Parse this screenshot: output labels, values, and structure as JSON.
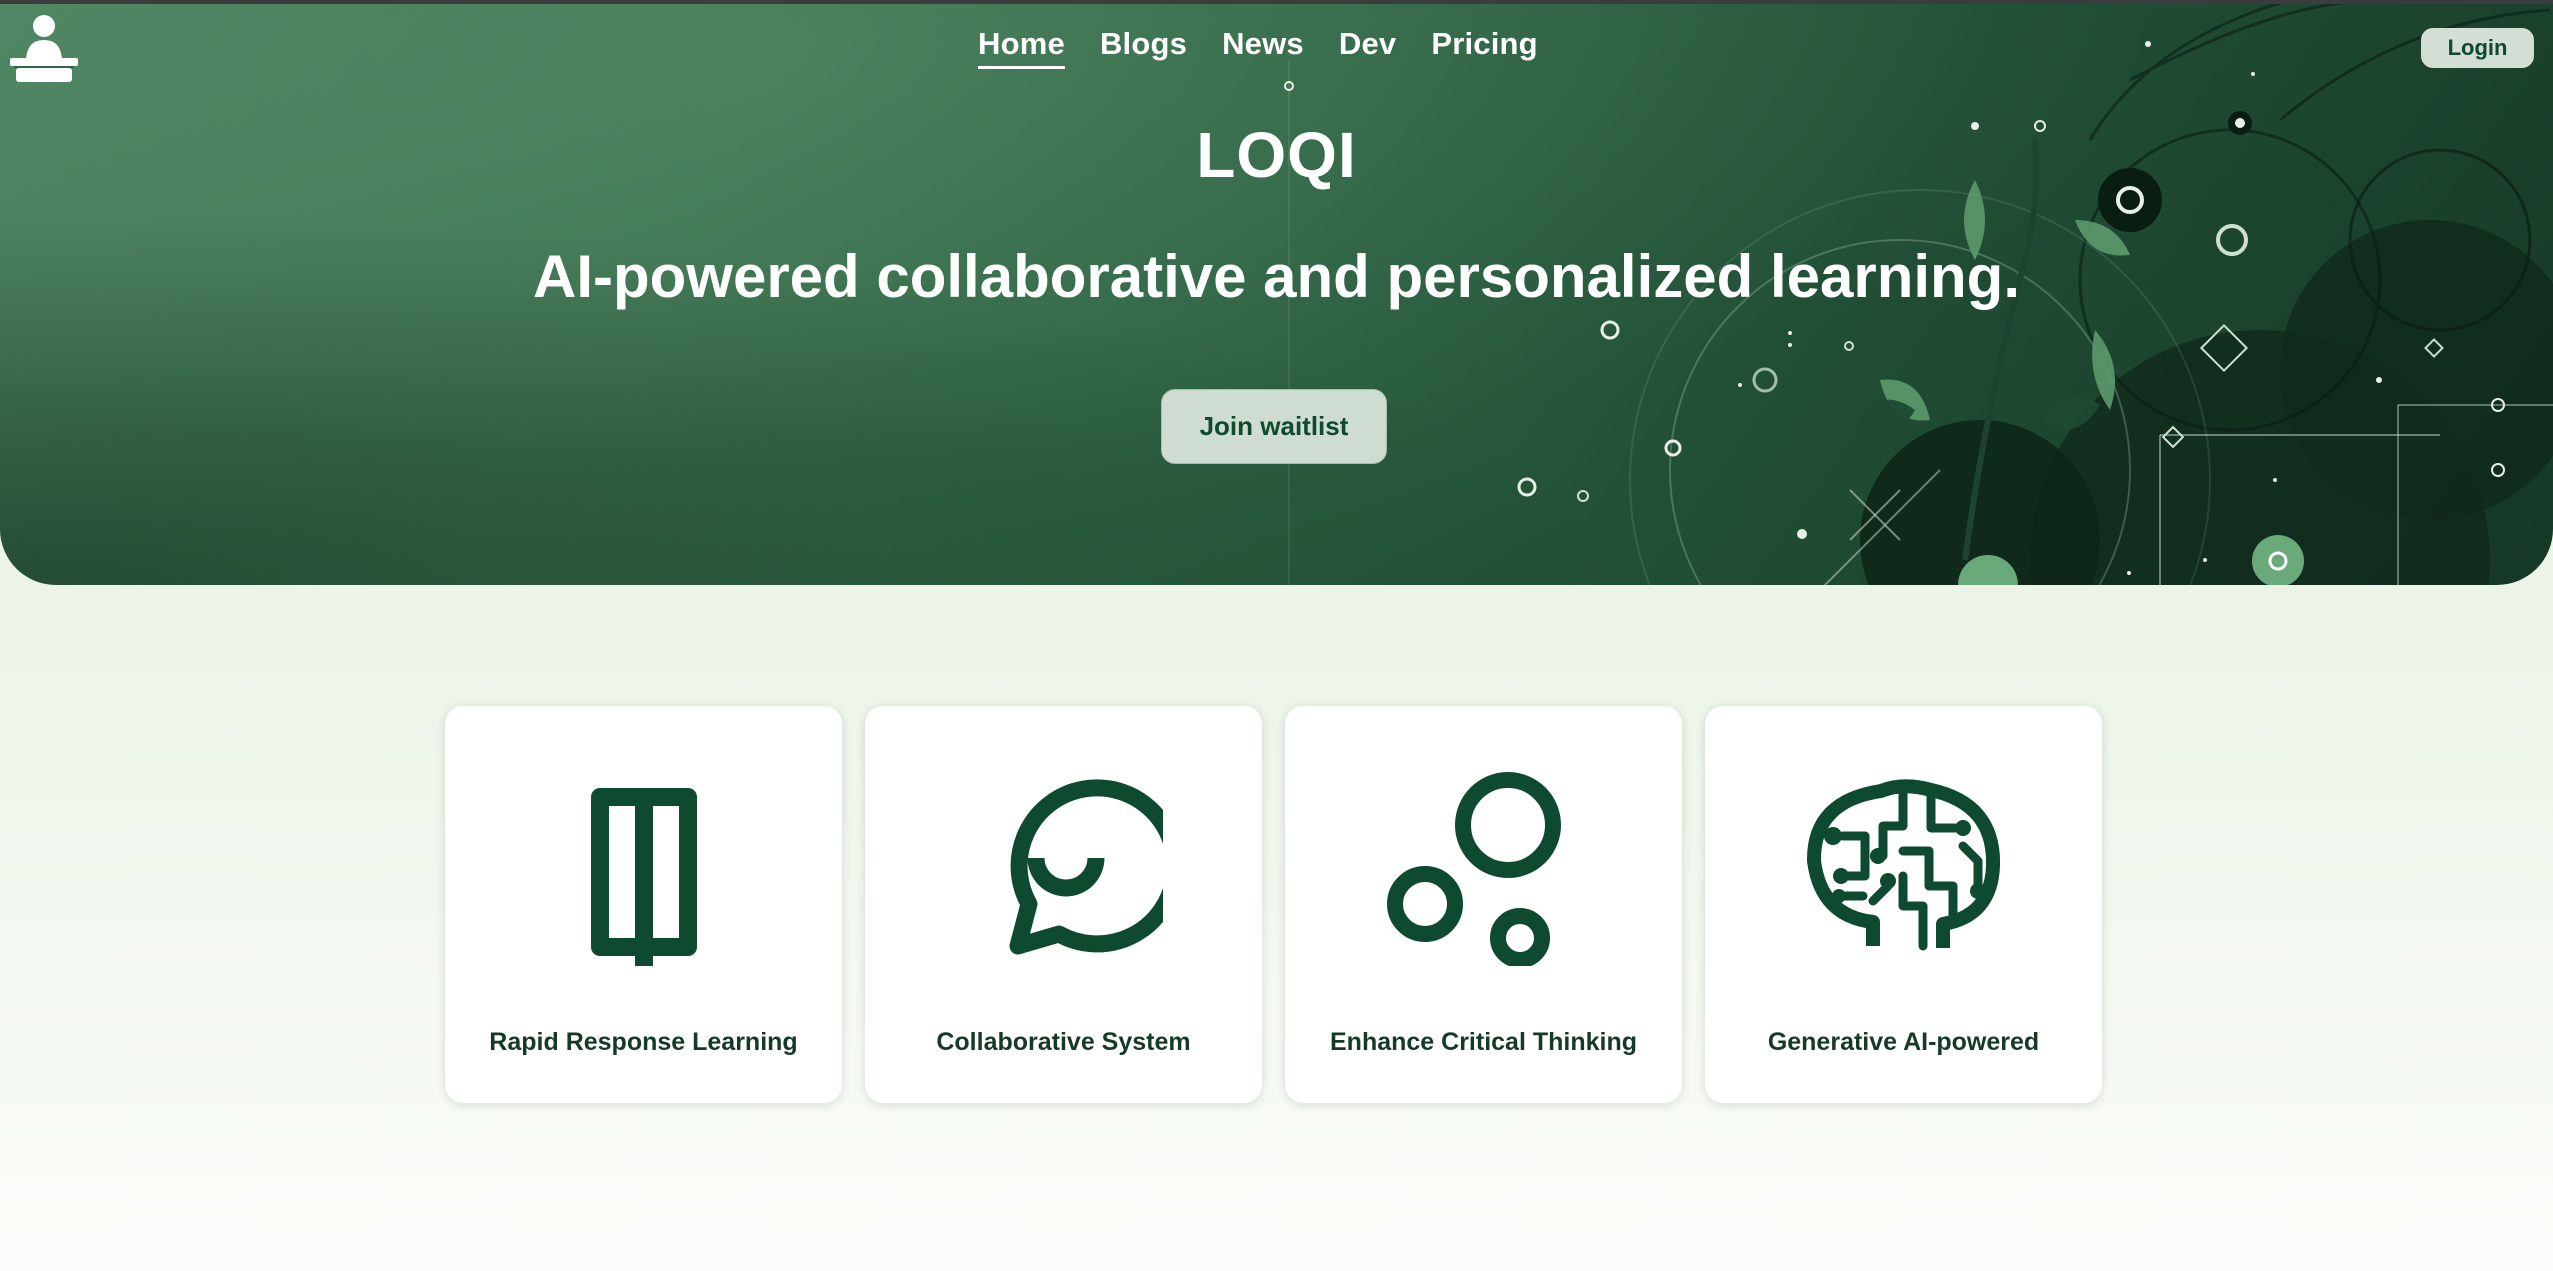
{
  "header": {
    "logo_icon": "person-reading-book-icon",
    "nav": [
      {
        "label": "Home",
        "active": true
      },
      {
        "label": "Blogs",
        "active": false
      },
      {
        "label": "News",
        "active": false
      },
      {
        "label": "Dev",
        "active": false
      },
      {
        "label": "Pricing",
        "active": false
      }
    ],
    "login_label": "Login"
  },
  "hero": {
    "title": "LOQI",
    "subtitle": "AI-powered collaborative and personalized learning.",
    "cta_label": "Join waitlist"
  },
  "features": [
    {
      "title": "Rapid Response Learning",
      "icon": "open-book-icon"
    },
    {
      "title": "Collaborative System",
      "icon": "chat-bubble-icon"
    },
    {
      "title": "Enhance Critical Thinking",
      "icon": "bubbles-icon"
    },
    {
      "title": "Generative AI-powered",
      "icon": "brain-circuit-icon"
    }
  ],
  "colors": {
    "brand_dark": "#0f4a2e",
    "icon_green": "#0d4a30",
    "hero_light": "#4c8260",
    "hero_dark": "#163726",
    "page_bg": "#e2efdc"
  }
}
